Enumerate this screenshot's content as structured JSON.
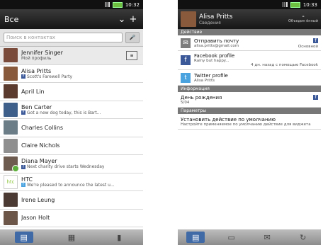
{
  "left": {
    "time": "10:32",
    "title": "Все",
    "search_placeholder": "Поиск в контактах",
    "contacts": [
      {
        "name": "Jennifer Singer",
        "sub": "Мой профиль",
        "sub_type": "none",
        "avatar_color": "#7a4b3a"
      },
      {
        "name": "Alisa Pritts",
        "sub": "Scott's Farewell Party",
        "sub_type": "facebook",
        "avatar_color": "#8a5a3c"
      },
      {
        "name": "April Lin",
        "sub": "",
        "sub_type": "none",
        "avatar_color": "#5b3b2e"
      },
      {
        "name": "Ben Carter",
        "sub": "Got a new dog today, this is Bart...",
        "sub_type": "facebook",
        "avatar_color": "#3e5f8a"
      },
      {
        "name": "Charles Collins",
        "sub": "",
        "sub_type": "none",
        "avatar_color": "#6b7d86"
      },
      {
        "name": "Claire Nichols",
        "sub": "",
        "sub_type": "none",
        "avatar_color": "#8f8f8f"
      },
      {
        "name": "Diana Mayer",
        "sub": "Next charity drive starts Wednesday",
        "sub_type": "facebook",
        "avatar_color": "#6e5b4f"
      },
      {
        "name": "HTC",
        "sub": "We're pleased to announce the latest u...",
        "sub_type": "twitter",
        "avatar_color": "#8fc63f",
        "avatar_text": "htc"
      },
      {
        "name": "Irene Leung",
        "sub": "",
        "sub_type": "none",
        "avatar_color": "#4b3a33"
      },
      {
        "name": "Jason Holt",
        "sub": "",
        "sub_type": "none",
        "avatar_color": "#6c5647"
      }
    ]
  },
  "right": {
    "time": "10:33",
    "name": "Alisa Pritts",
    "subtitle": "Сведения",
    "link_label": "Объедин ённый",
    "sections": {
      "actions": "Действие",
      "info": "Информация",
      "params": "Параметры"
    },
    "actions": [
      {
        "title": "Отправить почту",
        "sub": "alisa.pritts@gmail.com",
        "right": "Основной",
        "icon": "mail-icon"
      },
      {
        "title": "Facebook profile",
        "sub": "Rainy but happy...",
        "right": "4 дн. назад с помощью Facebook",
        "icon": "facebook-icon"
      },
      {
        "title": "Twitter profile",
        "sub": "Alisa Pritts",
        "right": "",
        "icon": "twitter-icon"
      }
    ],
    "info": [
      {
        "title": "День рождения",
        "sub": "5/04"
      }
    ],
    "params": [
      {
        "title": "Установить действие по умолчанию",
        "sub": "Настройте применяемое по умолчанию действие для виджета"
      }
    ]
  }
}
